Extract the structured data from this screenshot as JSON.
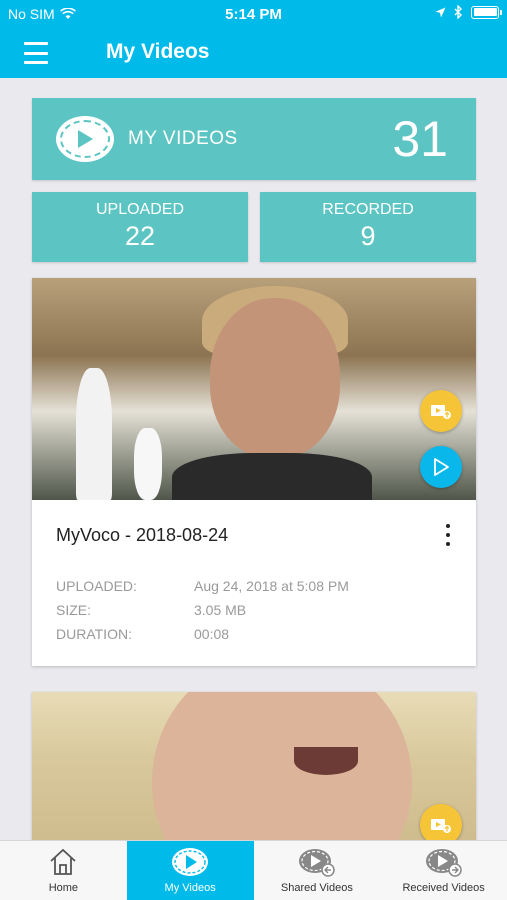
{
  "status_bar": {
    "carrier": "No SIM",
    "time": "5:14 PM"
  },
  "header": {
    "title": "My Videos"
  },
  "summary": {
    "main_label": "MY VIDEOS",
    "main_count": "31",
    "uploaded_label": "UPLOADED",
    "uploaded_count": "22",
    "recorded_label": "RECORDED",
    "recorded_count": "9"
  },
  "videos": [
    {
      "title": "MyVoco - 2018-08-24",
      "meta": [
        {
          "key": "UPLOADED:",
          "value": "Aug 24, 2018 at 5:08 PM"
        },
        {
          "key": "SIZE:",
          "value": "3.05 MB"
        },
        {
          "key": "DURATION:",
          "value": "00:08"
        }
      ]
    }
  ],
  "tabs": [
    {
      "label": "Home",
      "icon": "home-icon"
    },
    {
      "label": "My Videos",
      "icon": "video-play-icon"
    },
    {
      "label": "Shared Videos",
      "icon": "shared-video-icon"
    },
    {
      "label": "Received Videos",
      "icon": "received-video-icon"
    }
  ],
  "colors": {
    "primary": "#00bbe9",
    "teal": "#5cc5c3",
    "yellow_fab": "#f6c537",
    "blue_fab": "#0ab7ea"
  }
}
